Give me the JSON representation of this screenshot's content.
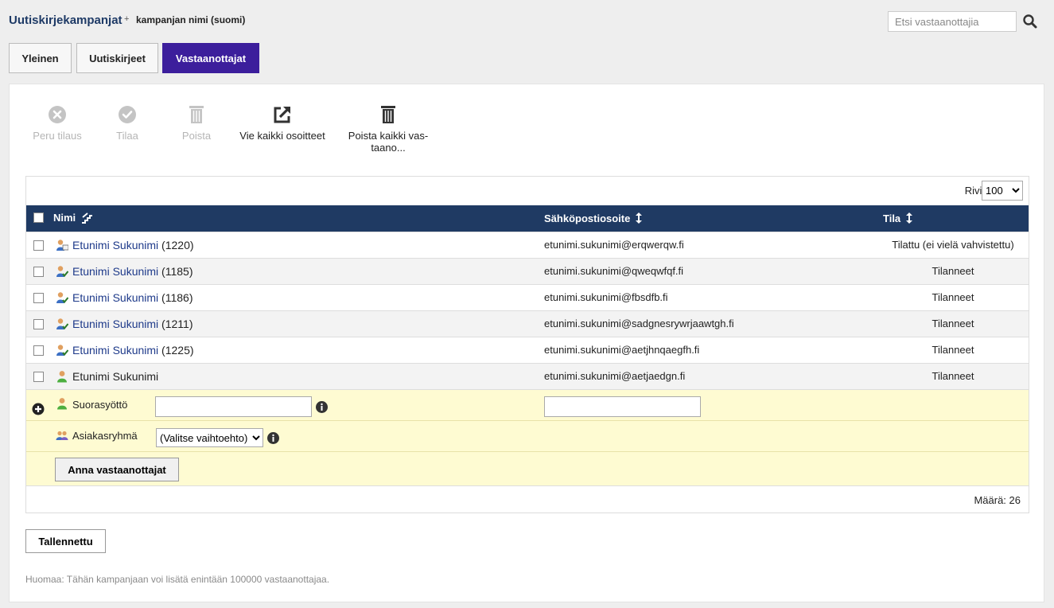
{
  "breadcrumb": {
    "parent": "Uutiskirjekampanjat",
    "separator": "+",
    "current": "kampanjan nimi (suomi)"
  },
  "search": {
    "placeholder": "Etsi vastaanottajia",
    "icon": "search-icon"
  },
  "tabs": [
    {
      "label": "Yleinen",
      "active": false
    },
    {
      "label": "Uutiskirjeet",
      "active": false
    },
    {
      "label": "Vastaanottajat",
      "active": true
    }
  ],
  "toolbar": {
    "unsubscribe": {
      "label": "Peru tilaus",
      "icon": "x-circle-icon",
      "enabled": false
    },
    "subscribe": {
      "label": "Tilaa",
      "icon": "check-circle-icon",
      "enabled": false
    },
    "delete": {
      "label": "Poista",
      "icon": "trash-icon",
      "enabled": false
    },
    "export": {
      "label": "Vie kaikki osoitteet",
      "icon": "external-link-icon",
      "enabled": true
    },
    "delete_all": {
      "label_line1": "Poista kaikki vas-",
      "label_line2": "taano...",
      "icon": "trash-icon",
      "enabled": true
    }
  },
  "grid": {
    "rows_label": "Rivit",
    "rows_value": "100",
    "columns": {
      "name": "Nimi",
      "email": "Sähköpostiosoite",
      "status": "Tila"
    },
    "rows": [
      {
        "name": "Etunimi Sukunimi",
        "id": "(1220)",
        "email": "etunimi.sukunimi@erqwerqw.fi",
        "status": "Tilattu (ei vielä vahvistettu)",
        "linked": true,
        "icon": "user-card-icon"
      },
      {
        "name": "Etunimi Sukunimi",
        "id": "(1185)",
        "email": "etunimi.sukunimi@qweqwfqf.fi",
        "status": "Tilanneet",
        "linked": true,
        "icon": "user-check-icon"
      },
      {
        "name": "Etunimi Sukunimi",
        "id": "(1186)",
        "email": "etunimi.sukunimi@fbsdfb.fi",
        "status": "Tilanneet",
        "linked": true,
        "icon": "user-check-icon"
      },
      {
        "name": "Etunimi Sukunimi",
        "id": "(1211)",
        "email": "etunimi.sukunimi@sadgnesrywrjaawtgh.fi",
        "status": "Tilanneet",
        "linked": true,
        "icon": "user-check-icon"
      },
      {
        "name": "Etunimi Sukunimi",
        "id": "(1225)",
        "email": "etunimi.sukunimi@aetjhnqaegfh.fi",
        "status": "Tilanneet",
        "linked": true,
        "icon": "user-check-icon"
      },
      {
        "name": "Etunimi Sukunimi",
        "id": "",
        "email": "etunimi.sukunimi@aetjaedgn.fi",
        "status": "Tilanneet",
        "linked": false,
        "icon": "user-icon"
      }
    ],
    "add": {
      "direct_label": "Suorasyöttö",
      "group_label": "Asiakasryhmä",
      "group_select": "(Valitse vaihtoehto)",
      "submit_label": "Anna vastaanottajat"
    },
    "count_label": "Määrä: 26"
  },
  "save_label": "Tallennettu",
  "note": "Huomaa: Tähän kampanjaan voi lisätä enintään 100000 vastaanottajaa.",
  "colors": {
    "accent": "#3c1e9c",
    "header": "#1f3a63",
    "add_bg": "#fefbd2",
    "link": "#1e3a8a"
  }
}
